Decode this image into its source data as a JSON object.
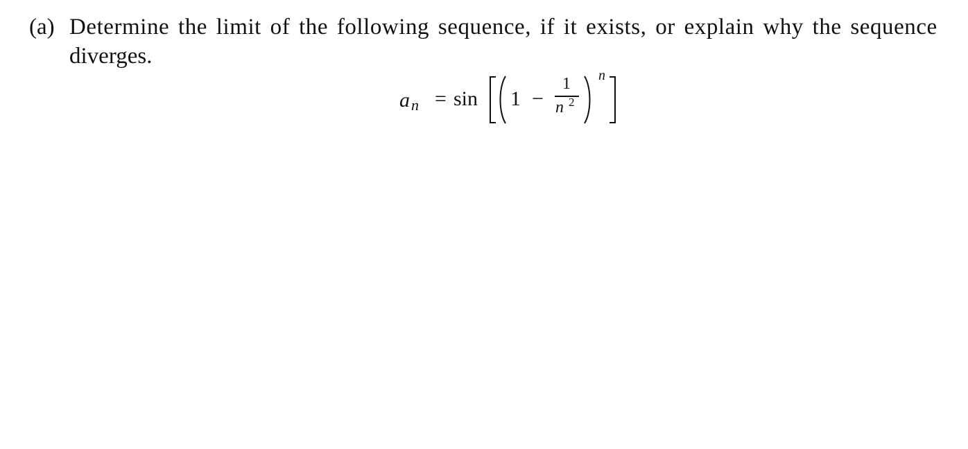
{
  "problem": {
    "label": "(a)",
    "text_line1": "Determine the limit of the following sequence, if it exists, or explain why the sequence",
    "text_line2": "diverges.",
    "formula": {
      "lhs_symbol": "a",
      "lhs_subscript": "n",
      "equals": "=",
      "function": "sin",
      "inner_constant": "1",
      "operator": "−",
      "fraction_numerator": "1",
      "fraction_denominator_base": "n",
      "fraction_denominator_exponent": "2",
      "outer_exponent": "n"
    }
  }
}
